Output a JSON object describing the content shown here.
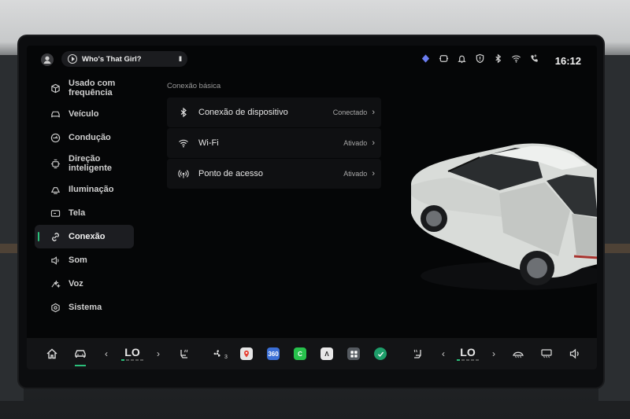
{
  "status_bar": {
    "song": "Who's That Girl?",
    "pause_symbol": "II",
    "time": "16:12",
    "icons": [
      "diamond-icon",
      "steering-icon",
      "bell-icon",
      "shield-icon",
      "bluetooth-icon",
      "wifi-icon",
      "phone-icon"
    ]
  },
  "sidebar": {
    "items": [
      {
        "label": "Usado com frequência",
        "icon": "cube-icon"
      },
      {
        "label": "Veículo",
        "icon": "car-front-icon"
      },
      {
        "label": "Condução",
        "icon": "gauge-icon"
      },
      {
        "label": "Direção inteligente",
        "icon": "smart-drive-icon"
      },
      {
        "label": "Iluminação",
        "icon": "light-icon"
      },
      {
        "label": "Tela",
        "icon": "display-icon"
      },
      {
        "label": "Conexão",
        "icon": "link-icon"
      },
      {
        "label": "Som",
        "icon": "speaker-icon"
      },
      {
        "label": "Voz",
        "icon": "voice-icon"
      },
      {
        "label": "Sistema",
        "icon": "system-icon"
      }
    ],
    "active_index": 6
  },
  "content": {
    "section_title": "Conexão básica",
    "rows": [
      {
        "label": "Conexão de dispositivo",
        "value": "Conectado",
        "icon": "bluetooth-icon"
      },
      {
        "label": "Wi-Fi",
        "value": "Ativado",
        "icon": "wifi-icon"
      },
      {
        "label": "Ponto de acesso",
        "value": "Ativado",
        "icon": "hotspot-icon"
      }
    ]
  },
  "dock": {
    "left_temp": "LO",
    "right_temp": "LO",
    "fan_level": "3",
    "prev_symbol": "‹",
    "next_symbol": "›",
    "apps": [
      {
        "name": "maps-app-icon",
        "color": "#e6e6e6"
      },
      {
        "name": "360-app-icon",
        "label": "360",
        "color": "#3b6fd6"
      },
      {
        "name": "carplay-app-icon",
        "label": "C",
        "color": "#27c24c"
      },
      {
        "name": "nav-app-icon",
        "label": "Λ",
        "color": "#e8e8e8"
      },
      {
        "name": "grid-app-icon",
        "color": "#555a60"
      },
      {
        "name": "check-app-icon",
        "color": "#1e9e6a"
      }
    ],
    "accent": "#2bbf7a"
  }
}
